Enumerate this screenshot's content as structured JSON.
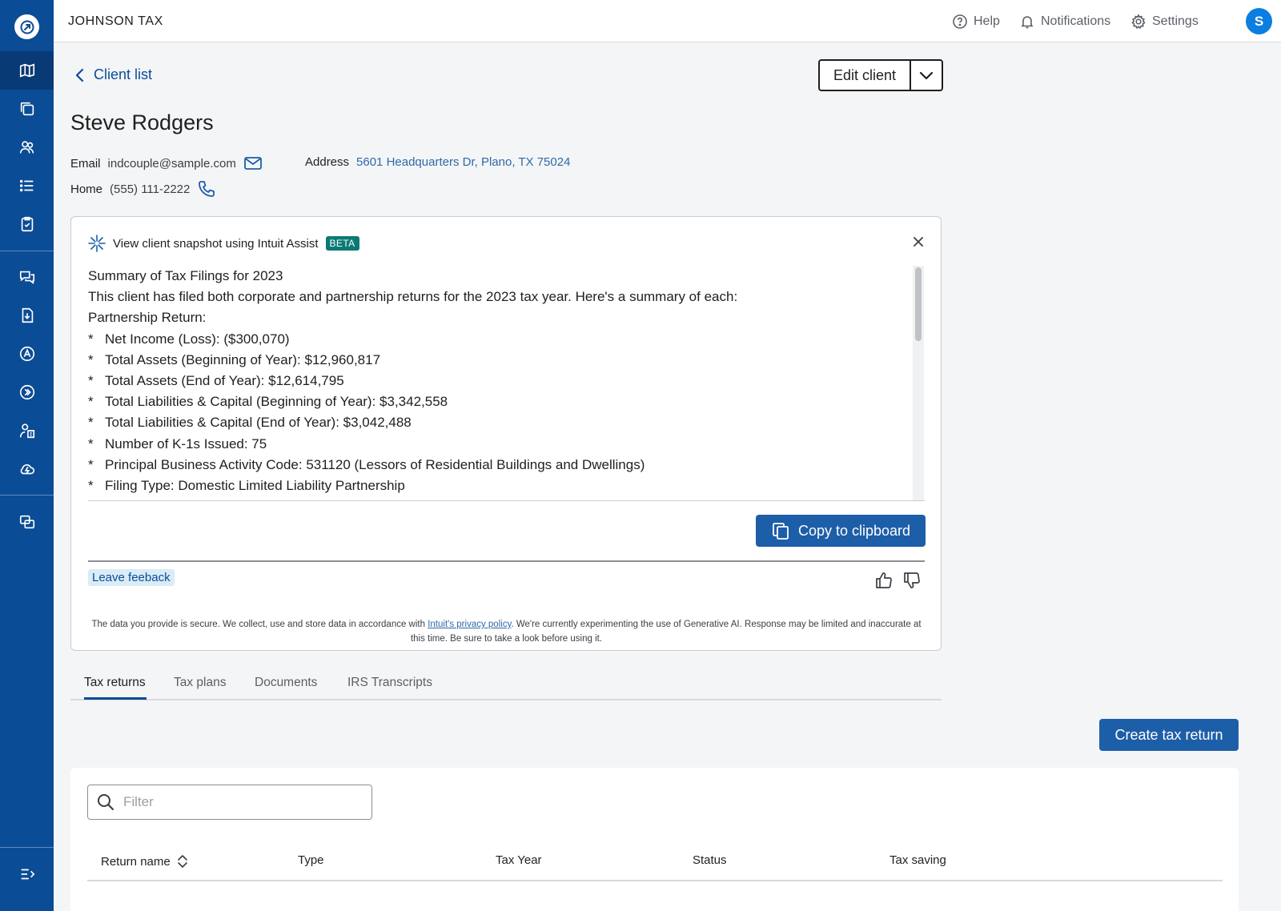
{
  "topbar": {
    "firm_name": "JOHNSON TAX",
    "help_label": "Help",
    "notifications_label": "Notifications",
    "settings_label": "Settings",
    "avatar_initial": "S"
  },
  "nav": {
    "back_label": "Client list",
    "edit_label": "Edit client"
  },
  "client": {
    "name": "Steve Rodgers",
    "email_label": "Email",
    "email": "indcouple@sample.com",
    "address_label": "Address",
    "address": "5601 Headquarters Dr, Plano, TX 75024",
    "phone_label": "Home",
    "phone": "(555) 111-2222"
  },
  "snapshot": {
    "title": "View client snapshot using Intuit Assist",
    "badge": "BETA",
    "summary_lines": [
      "Summary of Tax Filings for 2023",
      "This client has filed both corporate and partnership returns for the 2023 tax year.  Here's a summary of each:",
      "Partnership Return:"
    ],
    "bullets": [
      "Net Income (Loss): ($300,070)",
      "Total Assets (Beginning of Year): $12,960,817",
      "Total Assets (End of Year): $12,614,795",
      "Total Liabilities & Capital (Beginning of Year): $3,342,558",
      "Total Liabilities & Capital (End of Year): $3,042,488",
      "Number of K-1s Issued: 75",
      "Principal Business Activity Code: 531120 (Lessors of Residential Buildings and Dwellings)",
      "Filing Type: Domestic Limited Liability Partnership"
    ],
    "bullet_marker": "*",
    "copy_label": "Copy to clipboard",
    "feedback_label": "Leave feeback",
    "disclaimer_pre": "The data you provide is secure. We collect, use and store data in accordance with ",
    "disclaimer_link": "Intuit's privacy policy",
    "disclaimer_post": ". We're currently experimenting the use of Generative AI. Response may be limited and inaccurate at this time. Be sure to take a look before using it."
  },
  "tabs": {
    "tax_returns": "Tax returns",
    "tax_plans": "Tax plans",
    "documents": "Documents",
    "irs_transcripts": "IRS Transcripts"
  },
  "actions": {
    "create_label": "Create tax return"
  },
  "table": {
    "filter_placeholder": "Filter",
    "col_return_name": "Return name",
    "col_type": "Type",
    "col_tax_year": "Tax Year",
    "col_status": "Status",
    "col_tax_saving": "Tax saving"
  },
  "colors": {
    "sidebar": "#0b4c96",
    "primary_button": "#1d5ea8",
    "beta_badge": "#0b7a75",
    "avatar": "#0b7ee0"
  }
}
